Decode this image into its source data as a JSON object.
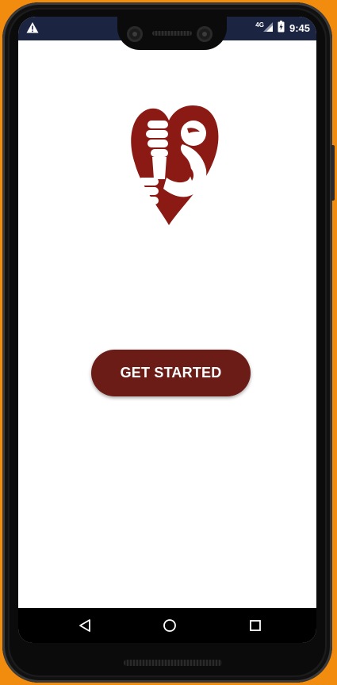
{
  "status_bar": {
    "alert_icon": "warning-icon",
    "network_type": "4G",
    "time": "9:45",
    "icons": [
      "signal-icon",
      "battery-charging-icon"
    ]
  },
  "brand": {
    "logo_icon": "heart-muscle-arm-logo",
    "color": "#8b1a14"
  },
  "main": {
    "cta_label": "GET STARTED",
    "cta_color": "#6b1c17"
  },
  "nav": {
    "icons": [
      "back-icon",
      "home-icon",
      "recents-icon"
    ]
  }
}
